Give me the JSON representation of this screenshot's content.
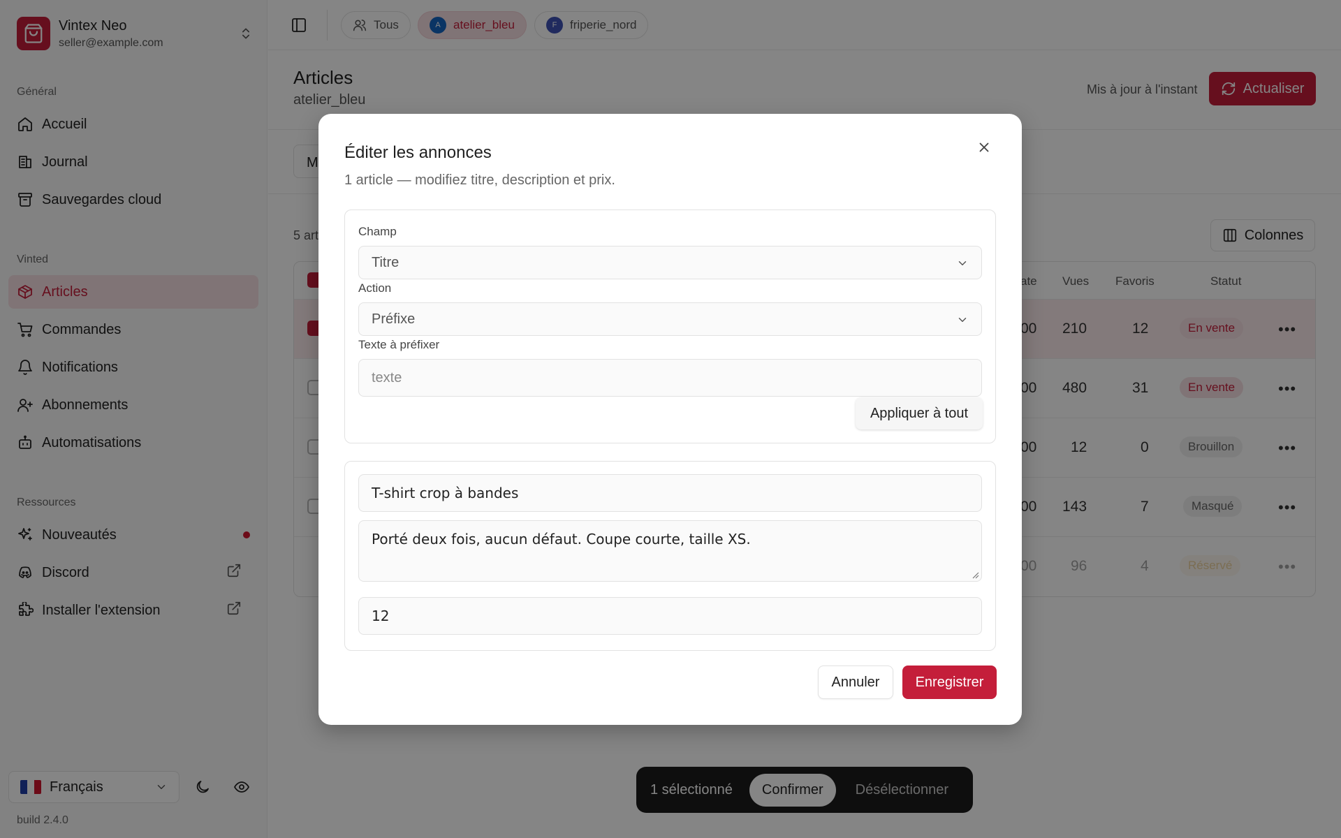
{
  "account": {
    "name": "Vintex Neo",
    "email": "seller@example.com"
  },
  "sidebar": {
    "groups": [
      {
        "label": "Général",
        "items": [
          {
            "label": "Accueil",
            "icon": "home-icon"
          },
          {
            "label": "Journal",
            "icon": "journal-icon"
          },
          {
            "label": "Sauvegardes cloud",
            "icon": "archive-icon"
          }
        ]
      },
      {
        "label": "Vinted",
        "items": [
          {
            "label": "Articles",
            "icon": "package-icon",
            "active": true
          },
          {
            "label": "Commandes",
            "icon": "cart-icon"
          },
          {
            "label": "Notifications",
            "icon": "bell-icon"
          },
          {
            "label": "Abonnements",
            "icon": "user-plus-icon"
          },
          {
            "label": "Automatisations",
            "icon": "bot-icon"
          }
        ]
      },
      {
        "label": "Ressources",
        "items": [
          {
            "label": "Nouveautés",
            "icon": "sparkles-icon"
          },
          {
            "label": "Discord",
            "icon": "discord-icon"
          },
          {
            "label": "Installer l'extension",
            "icon": "puzzle-icon"
          }
        ]
      }
    ],
    "language": "Français",
    "build": "build 2.4.0"
  },
  "topbar": {
    "filters": [
      {
        "label": "Tous"
      },
      {
        "label": "atelier_bleu",
        "avatar": "A",
        "active": true
      },
      {
        "label": "friperie_nord",
        "avatar": "F"
      }
    ]
  },
  "page": {
    "title": "Articles",
    "subtitle": "atelier_bleu",
    "updated": "Mis à jour à l'instant",
    "refresh_label": "Actualiser",
    "filter_label": "M",
    "count_label": "5 art",
    "columns_label": "Colonnes"
  },
  "table": {
    "headers": {
      "date": "ate",
      "views": "Vues",
      "favs": "Favoris",
      "status": "Statut"
    },
    "rows": [
      {
        "price": "00",
        "views": "210",
        "favs": "12",
        "status": "En vente",
        "selected": true
      },
      {
        "price": "00",
        "views": "480",
        "favs": "31",
        "status": "En vente"
      },
      {
        "price": "00",
        "views": "12",
        "favs": "0",
        "status": "Brouillon"
      },
      {
        "price": "00",
        "views": "143",
        "favs": "7",
        "status": "Masqué"
      },
      {
        "price": "00",
        "views": "96",
        "favs": "4",
        "status": "Réservé",
        "dim": true
      }
    ],
    "status_colors": {
      "En vente": "#c41e3a",
      "Brouillon": "#666666",
      "Masqué": "#666666",
      "Réservé": "#d39a2a"
    }
  },
  "bulk": {
    "selected_label": "1 sélectionné",
    "confirm_label": "Confirmer",
    "deselect_label": "Désélectionner"
  },
  "modal": {
    "title": "Éditer les annonces",
    "description": "1 article — modifiez titre, description et prix.",
    "field_label": "Champ",
    "field_value": "Titre",
    "action_label": "Action",
    "action_value": "Préfixe",
    "text_label": "Texte à préfixer",
    "text_placeholder": "texte",
    "apply_label": "Appliquer à tout",
    "item_title": "T-shirt crop à bandes",
    "item_description": "Porté deux fois, aucun défaut. Coupe courte, taille XS.",
    "item_price": "12",
    "cancel_label": "Annuler",
    "save_label": "Enregistrer"
  },
  "colors": {
    "accent": "#c41e3a",
    "accent_soft": "#f6dfe2"
  }
}
